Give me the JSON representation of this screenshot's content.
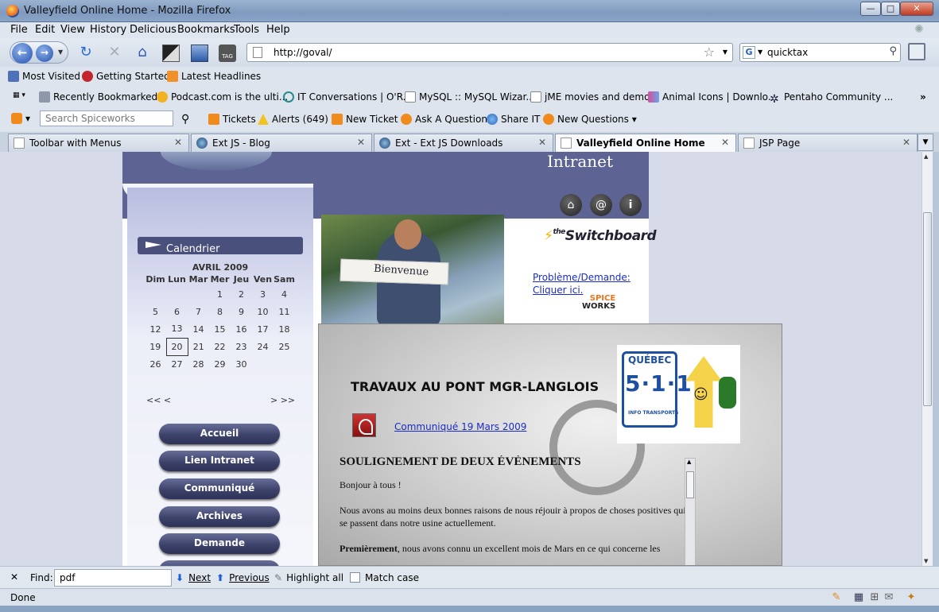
{
  "window": {
    "title": "Valleyfield Online Home - Mozilla Firefox",
    "controls": {
      "minimize": "—",
      "maximize": "□",
      "close": "✕"
    }
  },
  "menubar": {
    "items": [
      "File",
      "Edit",
      "View",
      "History",
      "Delicious",
      "Bookmarks",
      "Tools",
      "Help"
    ]
  },
  "navbar": {
    "url": "http://goval/",
    "search_engine": "G",
    "search_value": "quicktax"
  },
  "bookmarks": {
    "row1": [
      "Most Visited",
      "Getting Started",
      "Latest Headlines"
    ],
    "row2": [
      "Recently Bookmarked",
      "Podcast.com is the ulti...",
      "IT Conversations | O'R...",
      "MySQL :: MySQL Wizar...",
      "jME movies and demos",
      "Animal Icons | Downlo...",
      "Pentaho Community ..."
    ],
    "more": "»"
  },
  "spiceworks_toolbar": {
    "search_placeholder": "Search Spiceworks",
    "items": [
      "Tickets",
      "Alerts (649)",
      "New Ticket",
      "Ask A Question",
      "Share IT",
      "New Questions"
    ]
  },
  "tabs": [
    {
      "label": "Toolbar with Menus",
      "selected": false
    },
    {
      "label": "Ext JS - Blog",
      "selected": false
    },
    {
      "label": "Ext - Ext JS Downloads",
      "selected": false
    },
    {
      "label": "Valleyfield Online Home",
      "selected": true
    },
    {
      "label": "JSP Page",
      "selected": false
    }
  ],
  "site": {
    "header_title": "Intranet",
    "calendar": {
      "heading": "Calendrier",
      "month": "AVRIL 2009",
      "days": [
        "Dim",
        "Lun",
        "Mar",
        "Mer",
        "Jeu",
        "Ven",
        "Sam"
      ],
      "weeks": [
        [
          "",
          "",
          "",
          "1",
          "2",
          "3",
          "4"
        ],
        [
          "5",
          "6",
          "7",
          "8",
          "9",
          "10",
          "11"
        ],
        [
          "12",
          "13",
          "14",
          "15",
          "16",
          "17",
          "18"
        ],
        [
          "19",
          "20",
          "21",
          "22",
          "23",
          "24",
          "25"
        ],
        [
          "26",
          "27",
          "28",
          "29",
          "30",
          "",
          ""
        ]
      ],
      "today": "20",
      "prev": "<< <",
      "next": "> >>"
    },
    "nav_buttons": [
      "Accueil",
      "Lien Intranet",
      "Communiqué",
      "Archives",
      "Demande"
    ],
    "photo_sign": "Bienvenue",
    "switchboard": {
      "small": "the",
      "big": "Switchboard"
    },
    "problem_link": [
      "Problème/Demande:",
      "Cliquer ici."
    ],
    "spiceworks_logo": {
      "top": "SPICE",
      "bottom": "WORKS"
    },
    "news_title": "TRAVAUX AU PONT MGR-LANGLOIS",
    "communique_link": "Communiqué 19 Mars 2009",
    "qc511": {
      "top": "QUÉBEC",
      "number": "5·1·1",
      "caption": "INFO TRANSPORTS"
    },
    "article": {
      "heading": "SOULIGNEMENT DE DEUX ÉVÈNEMENTS",
      "p1": "Bonjour à tous !",
      "p2": "Nous avons au moins deux bonnes raisons de nous réjouir à propos de choses positives qui se passent dans notre usine actuellement.",
      "p3_bold": "Premièrement",
      "p3_rest": ", nous avons connu un excellent mois de Mars en ce qui concerne les"
    }
  },
  "findbar": {
    "label": "Find:",
    "value": "pdf",
    "next": "Next",
    "previous": "Previous",
    "highlight": "Highlight all",
    "match_case": "Match case"
  },
  "status": {
    "text": "Done"
  }
}
